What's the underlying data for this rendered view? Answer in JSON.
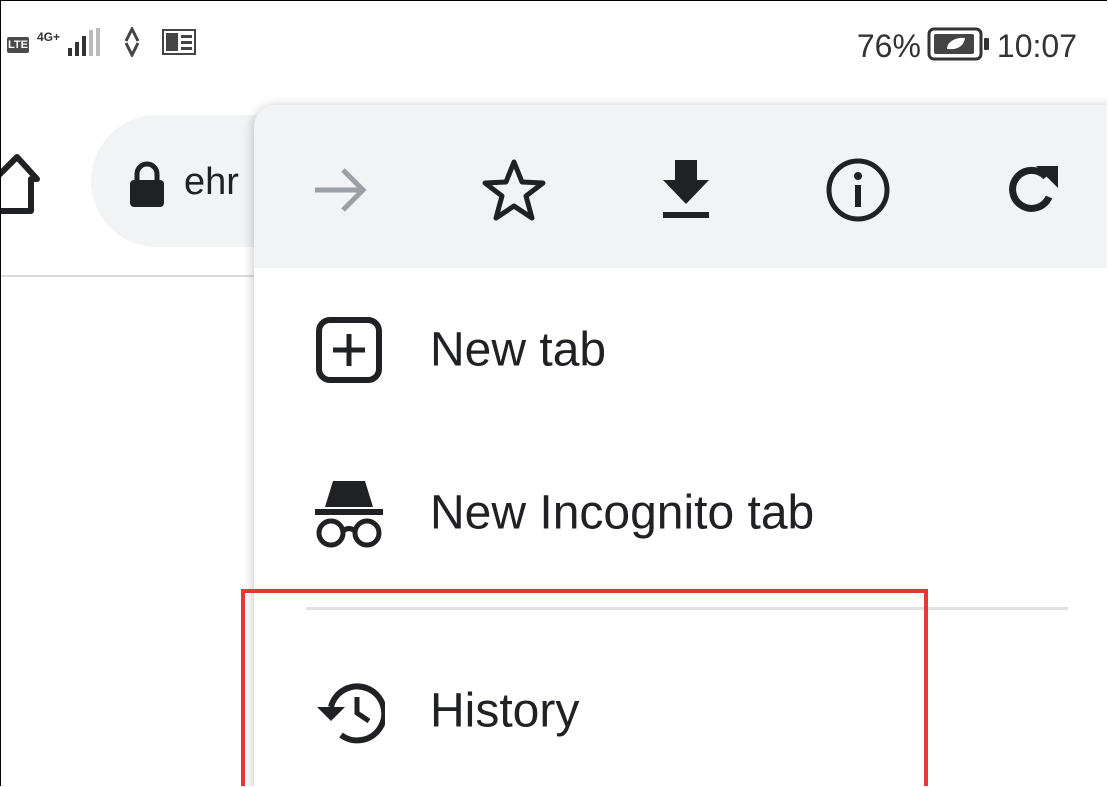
{
  "status_bar": {
    "lte": "LTE",
    "network": "4G+",
    "battery_percent": "76%",
    "time": "10:07"
  },
  "toolbar": {
    "url_fragment": "ehr"
  },
  "menu": {
    "icon_bar": [
      {
        "name": "forward-icon"
      },
      {
        "name": "star-icon"
      },
      {
        "name": "download-icon"
      },
      {
        "name": "info-icon"
      },
      {
        "name": "reload-icon"
      }
    ],
    "items": [
      {
        "icon": "new-tab-icon",
        "label": "New tab"
      },
      {
        "icon": "incognito-icon",
        "label": "New Incognito tab"
      },
      {
        "icon": "history-icon",
        "label": "History"
      }
    ]
  },
  "colors": {
    "highlight": "#e53935",
    "menu_header_bg": "#f1f3f4",
    "icon_dark": "#202124",
    "icon_disabled": "#9aa0a6"
  }
}
